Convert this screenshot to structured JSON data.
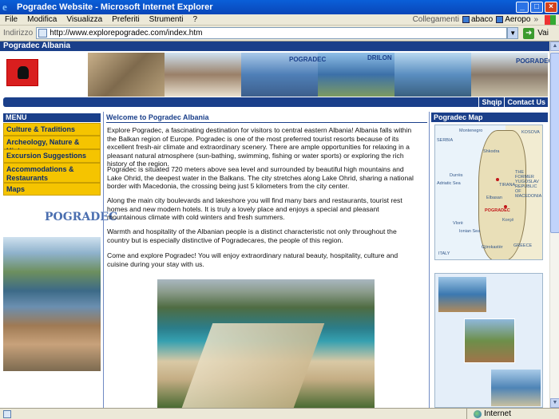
{
  "window": {
    "title": "Pogradec Website - Microsoft Internet Explorer",
    "controls": [
      "_",
      "□",
      "×"
    ]
  },
  "menubar": {
    "items": [
      "File",
      "Modifica",
      "Visualizza",
      "Preferiti",
      "Strumenti",
      "?"
    ],
    "links_label": "Collegamenti",
    "links": [
      "abaco",
      "Aeropo"
    ],
    "more": "»"
  },
  "address": {
    "label": "Indirizzo",
    "url": "http://www.explorepogradec.com/index.htm",
    "go_label": "Vai"
  },
  "site": {
    "title": "Pogradec Albania",
    "nav_links": [
      "Shqip",
      "Contact Us"
    ],
    "banner_labels": [
      "POGRADEC",
      "DRILON",
      "POGRADEC"
    ]
  },
  "menu": {
    "header": "MENU",
    "items": [
      "Culture & Traditions",
      "Archeology, Nature & History",
      "Excursion Suggestions",
      "Accommodations & Restaurants",
      "Maps"
    ],
    "logo_text": "POGRADEC"
  },
  "content": {
    "heading": "Welcome to Pogradec Albania",
    "paragraphs": [
      "Explore Pogradec, a fascinating destination for visitors to central eastern Albania! Albania falls within the Balkan region of Europe. Pogradec is one of the most preferred tourist resorts because of its excellent fresh-air climate and extraordinary scenery. There are ample opportunities for relaxing in a pleasant natural atmosphere (sun-bathing, swimming, fishing or water sports) or exploring the rich history of the region.",
      "Pogradec is situated 720 meters above sea level and surrounded by beautiful high mountains and Lake Ohrid, the deepest water in the Balkans. The city stretches along Lake Ohrid, sharing a national border with Macedonia, the crossing being just 5 kilometers from the city center.",
      "Along the main city boulevards and lakeshore you will find many bars and restaurants, tourist rest homes and new modern hotels. It is truly a lovely place and enjoys a special and pleasant mountainous climate with cold winters and fresh summers.",
      "Warmth and hospitality of the Albanian people is a distinct characteristic not only throughout the country but is especially distinctive of Pogradecares, the people of this region.",
      "Come and explore Pogradec! You will enjoy extraordinary natural beauty, hospitality, culture and cuisine during your stay with us."
    ]
  },
  "right": {
    "map_header": "Pogradec Map",
    "map_labels": {
      "montenegro": "Montenegro",
      "kosova": "KOSOVA",
      "serbia": "SERBIA",
      "shkodra": "Shkodra",
      "durres": "Durrës",
      "tirana": "TIRANA",
      "elbasan": "Elbasan",
      "pogradec": "POGRADEC",
      "korce": "Korçë",
      "vlore": "Vlorë",
      "adriatic": "Adriatic Sea",
      "ionian": "Ionian Sea",
      "macedonia": "THE FORMER YUGOSLAV REPUBLIC OF MACEDONIA",
      "italy": "ITALY",
      "greece": "GREECE",
      "gjirokaster": "Gjirokastër"
    }
  },
  "status": {
    "zone": "Internet"
  }
}
